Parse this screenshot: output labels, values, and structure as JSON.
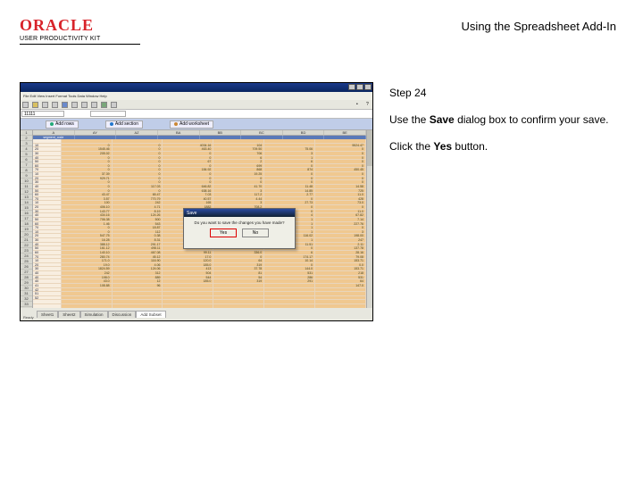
{
  "header": {
    "logo_text": "ORACLE",
    "logo_subtitle": "USER PRODUCTIVITY KIT",
    "page_title": "Using the Spreadsheet Add-In"
  },
  "instructions": {
    "step_label": "Step 24",
    "line1_a": "Use the ",
    "line1_bold": "Save",
    "line1_b": " dialog box to confirm your save.",
    "line2_a": "Click the ",
    "line2_bold": "Yes",
    "line2_b": " button."
  },
  "screenshot": {
    "menubar": "File  Edit  View  Insert  Format  Tools  Data  Window  Help",
    "name_box": "11111",
    "colheads": [
      "A",
      "AY",
      "AZ",
      "BA",
      "BB",
      "BC",
      "BD",
      "BE"
    ],
    "band": [
      "segment_code",
      "",
      "",
      "",
      "",
      "",
      "",
      ""
    ],
    "oracle_buttons": [
      {
        "label": "Add rows",
        "dot": "#2a7"
      },
      {
        "label": "Add section",
        "dot": "#27c"
      },
      {
        "label": "Add worksheet",
        "dot": "#c83"
      }
    ],
    "rownums": [
      "1",
      "2",
      "3",
      "4",
      "5",
      "6",
      "7",
      "8",
      "9",
      "10",
      "11",
      "12",
      "13",
      "14",
      "15",
      "16",
      "17",
      "18",
      "19",
      "20",
      "21",
      "22",
      "23",
      "24",
      "25",
      "26",
      "27",
      "28",
      "29",
      "30",
      "31",
      "32",
      "33",
      "34",
      "35",
      "36",
      "37",
      "38",
      "39",
      "40",
      "41",
      "42",
      "43",
      "44"
    ],
    "codes": [
      "",
      "10",
      "20",
      "30",
      "40",
      "50",
      "60",
      "70",
      "10",
      "20",
      "30",
      "40",
      "50",
      "60",
      "70",
      "10",
      "20",
      "30",
      "40",
      "50",
      "60",
      "70",
      "10",
      "20",
      "30",
      "40",
      "50",
      "60",
      "70",
      "10",
      "20",
      "30",
      "40",
      "40",
      "40",
      "41",
      "42",
      "51",
      "52"
    ],
    "cols_data": [
      [
        "",
        "0",
        "1545.46",
        "205.02",
        "0",
        "0",
        "0",
        "0",
        "37.39",
        "929.71",
        "0",
        "0",
        "0",
        "43.47",
        "3.57",
        "100",
        "406.10",
        "143.77",
        "434.16",
        "706.38",
        "1.46",
        "0",
        "0",
        "547.75",
        "16.28",
        "388.12",
        "161.12",
        "140.10",
        "280.74",
        "171.0",
        "19.0",
        "1824.59",
        "242",
        "198.0",
        "43.0",
        "108.88"
      ],
      [
        "",
        "0",
        "0",
        "0",
        "0",
        "0",
        "0",
        "0",
        "0",
        "0",
        "0",
        "117.03",
        "0",
        "65.47",
        "770.79",
        "242",
        "4.71",
        "8.19",
        "124.26",
        "500",
        "543",
        "18.87",
        "112",
        "0.38",
        "8.31",
        "291.17",
        "498.11",
        "467.08",
        "45.12",
        "116.90",
        "4.06",
        "124.06",
        "312",
        "889",
        "12",
        "96"
      ],
      [
        "",
        "4034.16",
        "463.40",
        "0",
        "0",
        "67",
        "0",
        "184.92",
        "0",
        "0",
        "0",
        "646.82",
        "638.16",
        "7.03",
        "40.57",
        "165",
        "1882",
        "12",
        "42",
        "436.0",
        "443.11",
        "55.62",
        "78.91",
        "382.14",
        "291.17",
        "136.50",
        "227.20",
        "99.11",
        "17.0",
        "120.0",
        "185.0",
        "413",
        "504",
        "544",
        "185.0"
      ],
      [
        "",
        "104",
        "709.50",
        "706",
        "6",
        "2",
        "699",
        "868",
        "19.25",
        "0",
        "0",
        "41.70",
        "3",
        "117.2",
        "4.44",
        "3",
        "708.2",
        "5",
        "0",
        "114",
        "698",
        "46.25",
        "115.94",
        "67.72",
        "198.72",
        "316.83",
        "36.88",
        "336.0",
        "0",
        "64",
        "319",
        "37.78",
        "81",
        "54",
        "319"
      ],
      [
        "",
        "",
        "75.06",
        "3",
        "1",
        "6",
        "0",
        "874",
        "0",
        "0",
        "0",
        "11.48",
        "14.85",
        "2.77",
        "0",
        "27.73",
        "0",
        "0",
        "4",
        "1",
        "1",
        "1",
        "1",
        "116.02",
        "1",
        "11.51",
        "0",
        "6",
        "174.17",
        "10.14",
        "0",
        "144.0",
        "531",
        "286",
        "291"
      ],
      [
        "",
        "5524.47",
        "0",
        "0",
        "0",
        "0",
        "0",
        "450.45",
        "0",
        "0",
        "0",
        "14.58",
        "725",
        "11.0",
        "428",
        "73.0",
        "0",
        "11.0",
        "67.82",
        "7.14",
        "227.76",
        "0",
        "3",
        "198.00",
        "247",
        "2.11",
        "137.78",
        "28.16",
        "79.08",
        "153.71",
        "0.0",
        "153.71",
        "218",
        "531",
        "64",
        "147.0"
      ]
    ],
    "sheet_tabs": [
      "Sheet1",
      "Sheet2",
      "Simulation",
      "Discussion",
      "Add Subset"
    ],
    "ready": "Ready",
    "dialog": {
      "title": "Save",
      "message": "Do you want to save the changes you have made?",
      "yes": "Yes",
      "no": "No"
    }
  }
}
